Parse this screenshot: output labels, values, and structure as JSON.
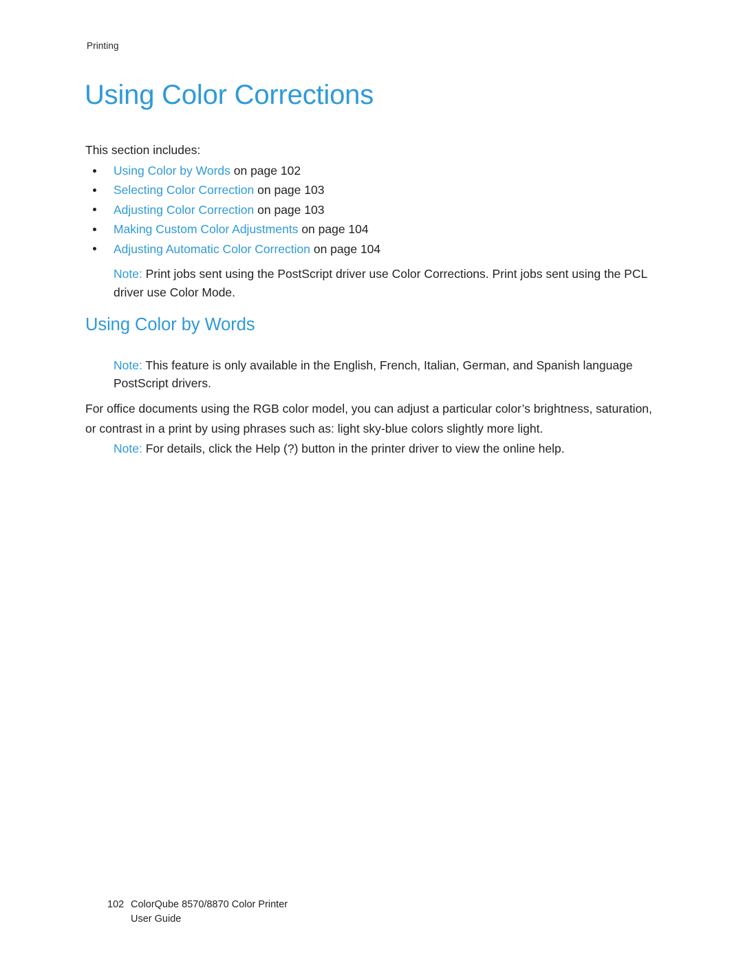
{
  "page": {
    "running_header": "Printing",
    "chapter_title": "Using Color Corrections",
    "background_color": "#ffffff",
    "accent_color": "#2e9ad9",
    "text_color": "#231f20"
  },
  "intro": {
    "line": "This section includes:"
  },
  "toc_list": [
    {
      "link": "Using Color by Words",
      "suffix": " on page 102"
    },
    {
      "link": "Selecting Color Correction",
      "suffix": " on page 103"
    },
    {
      "link": "Adjusting Color Correction",
      "suffix": " on page 103"
    },
    {
      "link": "Making Custom Color Adjustments",
      "suffix": " on page 104"
    },
    {
      "link": "Adjusting Automatic Color Correction",
      "suffix": " on page 104"
    }
  ],
  "note_1": {
    "label": "Note:",
    "text": " Print jobs sent using the PostScript driver use Color Corrections. Print jobs sent using the PCL driver use Color Mode."
  },
  "section": {
    "heading": "Using Color by Words"
  },
  "note_2": {
    "label": "Note:",
    "text": " This feature is only available in the English, French, Italian, German, and Spanish language PostScript drivers."
  },
  "body_paragraph": {
    "text": "For office documents using the RGB color model, you can adjust a particular color’s brightness, saturation, or contrast in a print by using phrases such as: light sky-blue colors slightly more light."
  },
  "note_3": {
    "label": "Note:",
    "prefix": " For details, click the Help (",
    "bold": "?",
    "suffix": ") button in the printer driver to view the online help."
  },
  "footer": {
    "page_number": "102",
    "doc_title": "ColorQube 8570/8870 Color Printer",
    "doc_subtitle": "User Guide"
  }
}
